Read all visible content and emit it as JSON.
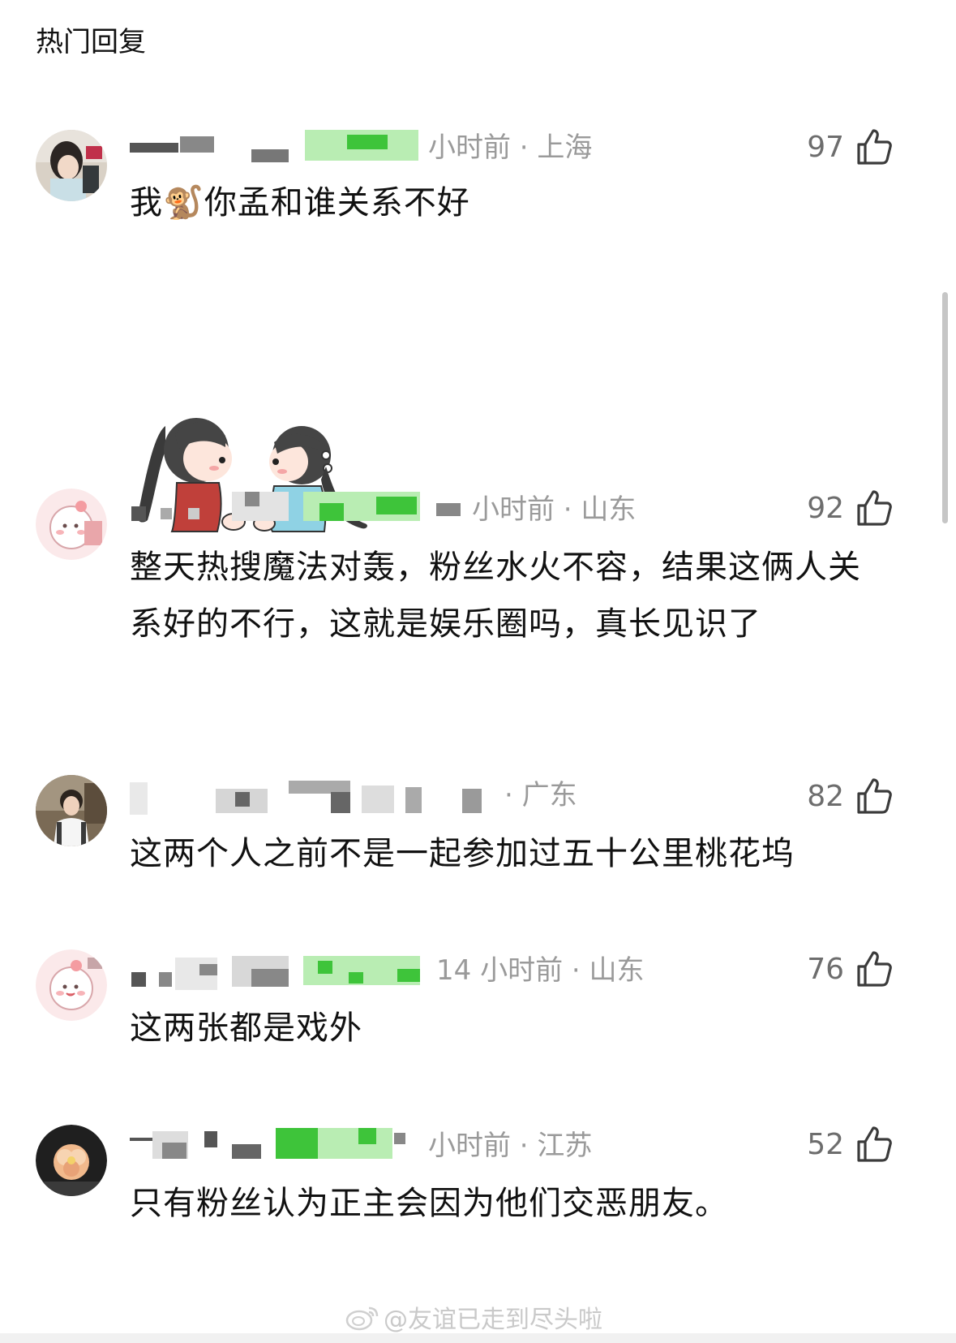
{
  "section_title": "热门回复",
  "comments": [
    {
      "time_location": "小时前 · 上海",
      "likes": "97",
      "text_before_emoji": "我",
      "emoji": "🐒",
      "text_after_emoji": "你孟和谁关系不好",
      "has_sticker": true
    },
    {
      "time_location": "小时前 · 山东",
      "likes": "92",
      "text": "整天热搜魔法对轰，粉丝水火不容，结果这俩人关系好的不行，这就是娱乐圈吗，真长见识了"
    },
    {
      "time_location": "· 广东",
      "likes": "82",
      "text": "这两个人之前不是一起参加过五十公里桃花坞"
    },
    {
      "time_location": "14 小时前 · 山东",
      "likes": "76",
      "text": "这两张都是戏外"
    },
    {
      "time_location": "小时前 · 江苏",
      "likes": "52",
      "text": "只有粉丝认为正主会因为他们交恶朋友。"
    }
  ],
  "watermark": "@友谊已走到尽头啦",
  "icons": {
    "like": "thumbs-up-icon",
    "watermark": "weibo-icon"
  },
  "colors": {
    "meta_gray": "#9a9a9a",
    "like_gray": "#6d6d6d",
    "mosaic_green": "#3ec43a"
  }
}
